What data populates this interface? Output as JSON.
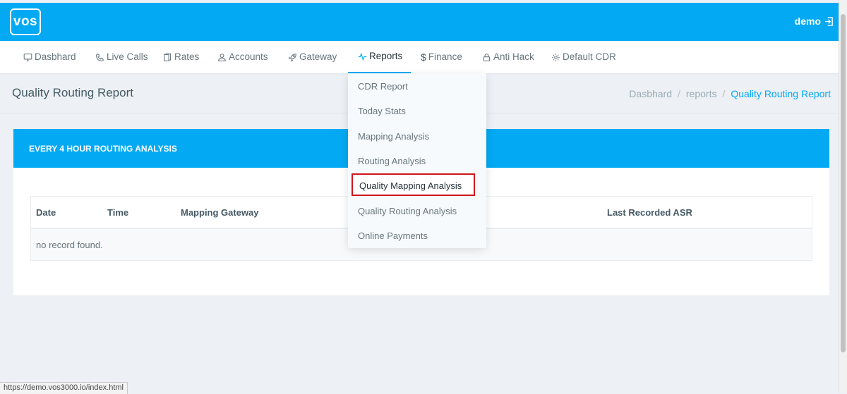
{
  "brand": {
    "logo_text": "vos"
  },
  "header": {
    "user_label": "demo"
  },
  "nav": [
    {
      "label": "Dasbhard",
      "icon": "monitor-icon"
    },
    {
      "label": "Live Calls",
      "icon": "phone-icon"
    },
    {
      "label": "Rates",
      "icon": "documents-icon"
    },
    {
      "label": "Accounts",
      "icon": "user-icon"
    },
    {
      "label": "Gateway",
      "icon": "rocket-icon"
    },
    {
      "label": "Reports",
      "icon": "pulse-icon",
      "active": true
    },
    {
      "label": "Finance",
      "icon": "dollar-icon"
    },
    {
      "label": "Anti Hack",
      "icon": "lock-icon"
    },
    {
      "label": "Default CDR",
      "icon": "gear-icon"
    }
  ],
  "page": {
    "title": "Quality Routing Report",
    "breadcrumb": [
      "Dasbhard",
      "reports",
      "Quality Routing Report"
    ]
  },
  "card": {
    "title": "EVERY 4 HOUR ROUTING ANALYSIS",
    "table": {
      "columns": [
        "Date",
        "Time",
        "Mapping Gateway",
        "Last Recorded ASR"
      ],
      "empty_text": "no record found."
    }
  },
  "reports_menu": {
    "items": [
      "CDR Report",
      "Today Stats",
      "Mapping Analysis",
      "Routing Analysis",
      "Quality Mapping Analysis",
      "Quality Routing Analysis",
      "Online Payments"
    ],
    "highlighted_index": 4
  },
  "status_bar": {
    "url": "https://demo.vos3000.io/index.html"
  },
  "colors": {
    "primary": "#03a9f3",
    "highlight_border": "#d0161b",
    "background": "#edf0f5"
  }
}
